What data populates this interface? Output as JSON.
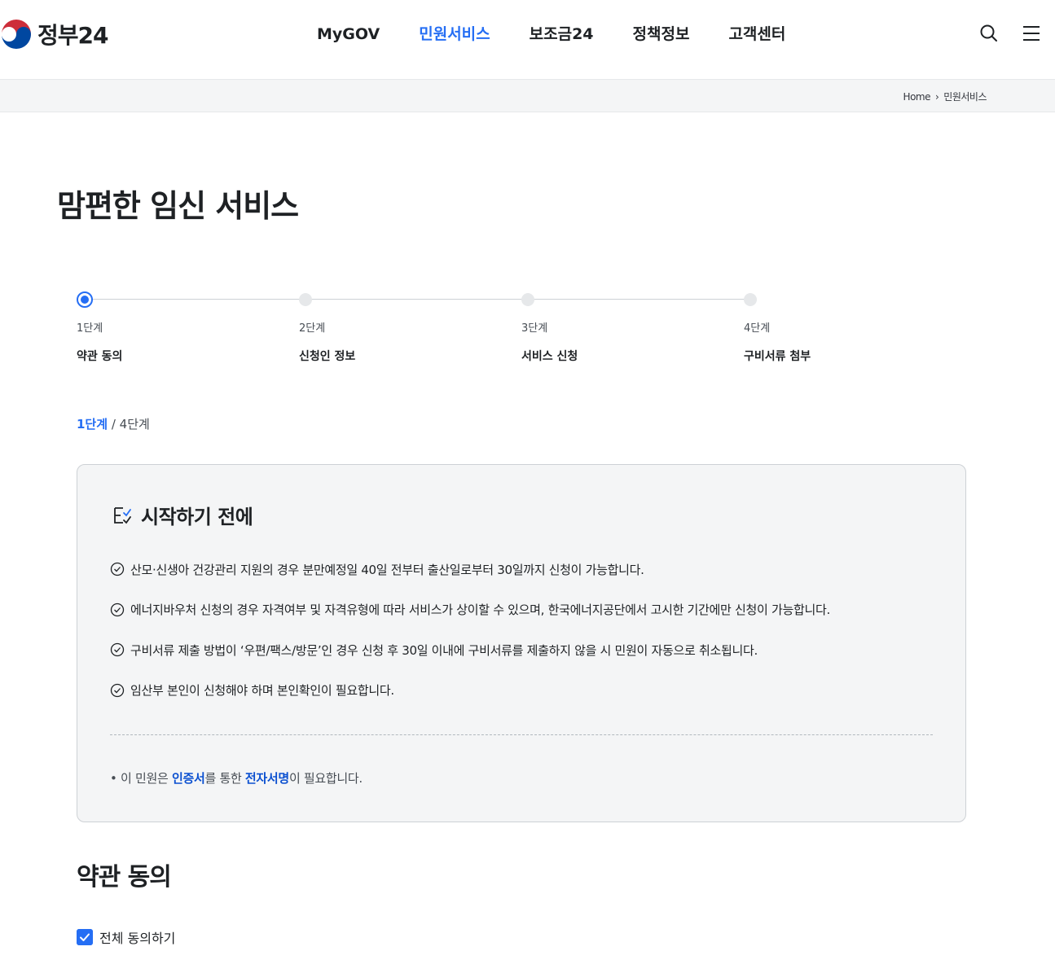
{
  "header": {
    "logo_text": "정부24",
    "nav": [
      "MyGOV",
      "민원서비스",
      "보조금24",
      "정책정보",
      "고객센터"
    ],
    "active_nav": "민원서비스"
  },
  "breadcrumb": {
    "home": "Home",
    "current": "민원서비스"
  },
  "page": {
    "title": "맘편한 임신 서비스"
  },
  "stepper": {
    "steps": [
      {
        "num": "1단계",
        "name": "약관 동의"
      },
      {
        "num": "2단계",
        "name": "신청인 정보"
      },
      {
        "num": "3단계",
        "name": "서비스 신청"
      },
      {
        "num": "4단계",
        "name": "구비서류 첨부"
      }
    ],
    "current_label": "1단계",
    "total_label": "4단계",
    "separator": "/"
  },
  "notice": {
    "title": "시작하기 전에",
    "items": [
      "산모·신생아 건강관리 지원의 경우 분만예정일 40일 전부터 출산일로부터 30일까지 신청이 가능합니다.",
      "에너지바우처 신청의 경우 자격여부 및 자격유형에 따라 서비스가 상이할 수 있으며, 한국에너지공단에서 고시한 기간에만 신청이 가능합니다.",
      "구비서류 제출 방법이 ‘우편/팩스/방문’인 경우 신청 후 30일 이내에 구비서류를 제출하지 않을 시 민원이 자동으로 취소됩니다.",
      "임산부 본인이 신청해야 하며 본인확인이 필요합니다."
    ],
    "note": {
      "bullet": "•",
      "pre": "이 민원은 ",
      "em1": "인증서",
      "mid": "를 통한 ",
      "em2": "전자서명",
      "post": "이 필요합니다."
    }
  },
  "terms": {
    "title": "약관 동의",
    "agree_all_label": "전체 동의하기",
    "agree_all_checked": true
  },
  "colors": {
    "accent": "#256ef4",
    "accent_dark": "#0b50d0",
    "text": "#1e2124"
  }
}
